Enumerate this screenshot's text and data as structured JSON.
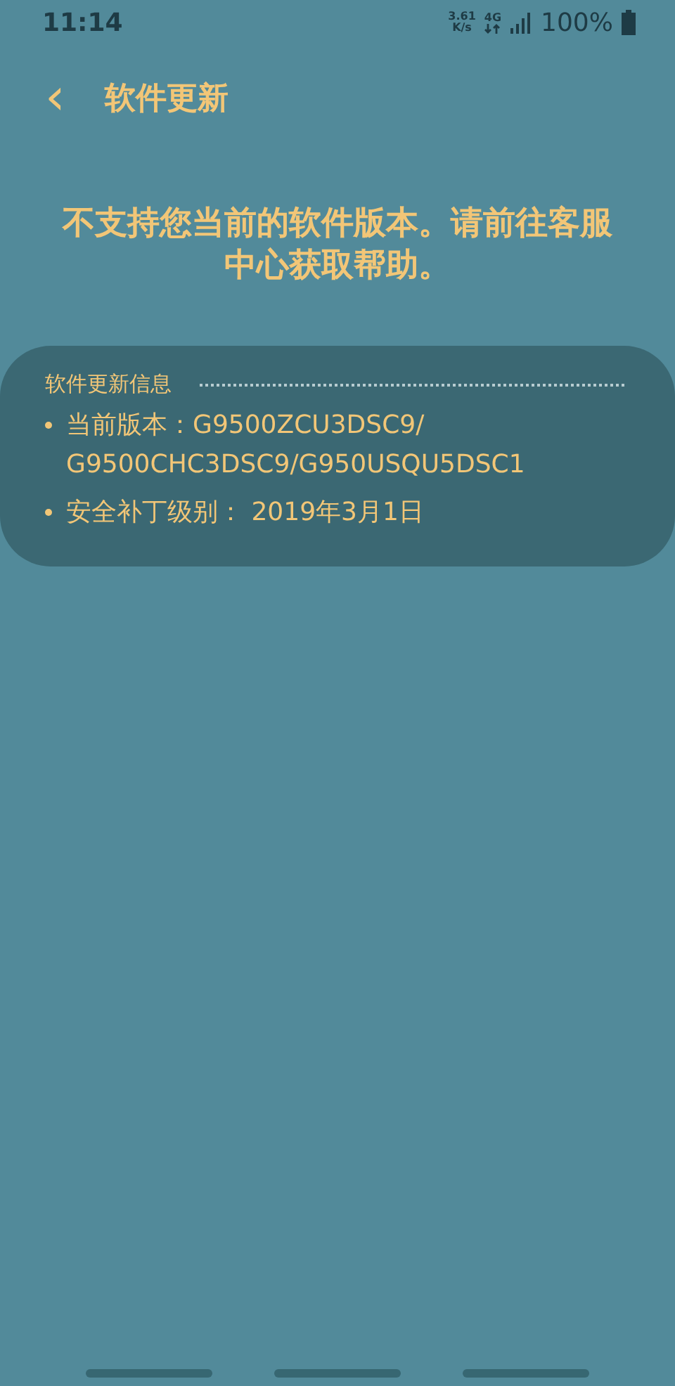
{
  "status_bar": {
    "time": "11:14",
    "speed_value": "3.61",
    "speed_unit": "K/s",
    "network": "4G",
    "battery": "100%"
  },
  "header": {
    "back_icon": "‹",
    "title": "软件更新"
  },
  "message": "不支持您当前的软件版本。请前往客服中心获取帮助。",
  "info_card": {
    "title": "软件更新信息",
    "items": [
      {
        "text": "当前版本：G9500ZCU3DSC9/G9500CHC3DSC9/G950USQU5DSC1"
      },
      {
        "text": "安全补丁级别： 2019年3月1日"
      }
    ]
  }
}
